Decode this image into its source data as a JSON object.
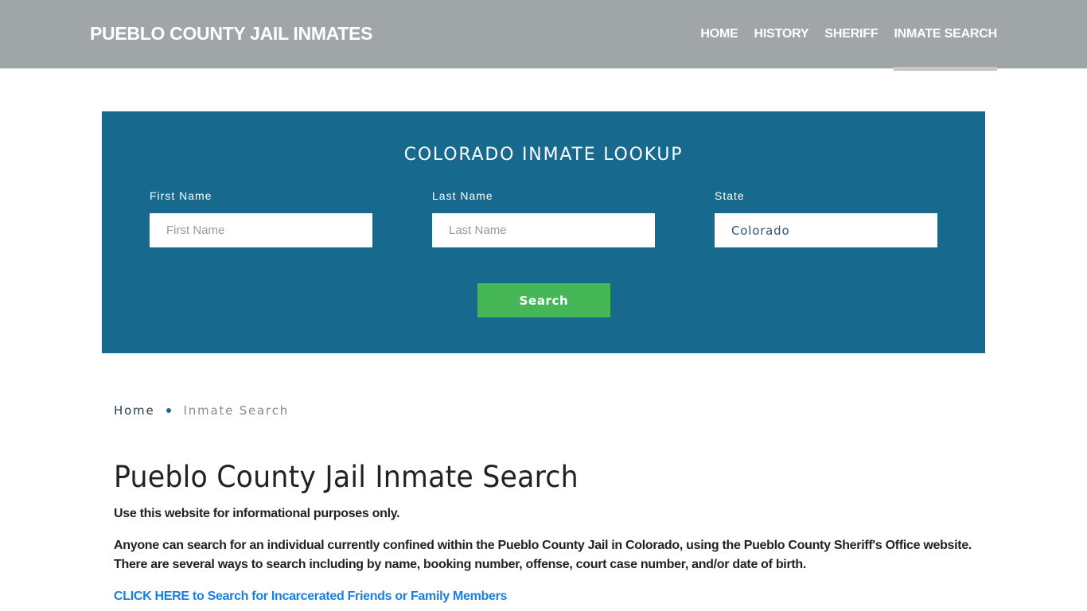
{
  "header": {
    "brand": "PUEBLO COUNTY JAIL INMATES",
    "nav": [
      {
        "label": "HOME",
        "active": false
      },
      {
        "label": "HISTORY",
        "active": false
      },
      {
        "label": "SHERIFF",
        "active": false
      },
      {
        "label": "INMATE SEARCH",
        "active": true
      }
    ]
  },
  "lookup": {
    "title": "COLORADO INMATE LOOKUP",
    "first_name": {
      "label": "First Name",
      "placeholder": "First Name",
      "value": ""
    },
    "last_name": {
      "label": "Last Name",
      "placeholder": "Last Name",
      "value": ""
    },
    "state": {
      "label": "State",
      "value": "Colorado"
    },
    "search_button": "Search"
  },
  "breadcrumb": {
    "home": "Home",
    "current": "Inmate Search"
  },
  "content": {
    "title": "Pueblo County Jail Inmate Search",
    "paragraph1": "Use this website for informational purposes only.",
    "paragraph2": "Anyone can search for an individual currently confined within the Pueblo County Jail in Colorado, using the Pueblo County Sheriff's Office website. There are several ways to search including by name, booking number, offense, court case number, and/or date of birth.",
    "cta_link": "CLICK HERE to Search for Incarcerated Friends or Family Members"
  },
  "colors": {
    "header_bg": "#a0a5a8",
    "lookup_bg": "#176a8e",
    "search_button": "#45b757",
    "link": "#1a7fe0"
  }
}
